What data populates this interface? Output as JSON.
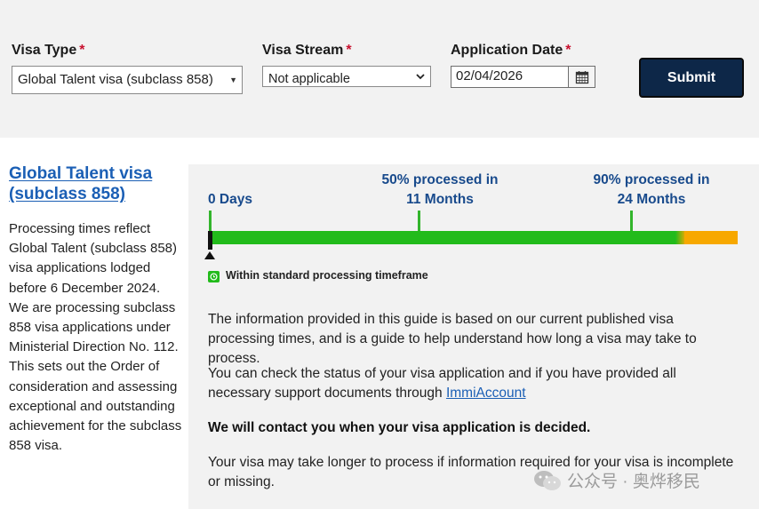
{
  "form": {
    "visa_type": {
      "label": "Visa Type",
      "required_mark": "*",
      "value": "Global Talent visa (subclass 858)"
    },
    "visa_stream": {
      "label": "Visa Stream",
      "required_mark": "*",
      "value": "Not applicable"
    },
    "application_date": {
      "label": "Application Date",
      "required_mark": "*",
      "value": "02/04/2026"
    },
    "submit_label": "Submit"
  },
  "visa": {
    "title_line1": "Global Talent visa",
    "title_line2": "(subclass 858)",
    "description": "Processing times reflect Global Talent (subclass 858) visa applications lodged before 6 December 2024. We are processing subclass 858 visa applications under Ministerial Direction No. 112. This sets out the Order of consideration and assessing exceptional and outstanding achievement for the subclass 858 visa."
  },
  "timeline": {
    "start": {
      "line1": "0 Days"
    },
    "p50": {
      "line1": "50% processed in",
      "line2": "11 Months"
    },
    "p90": {
      "line1": "90% processed in",
      "line2": "24 Months"
    },
    "legend": "Within standard processing timeframe",
    "colors": {
      "within": "#22bb1b",
      "beyond": "#f7a800"
    }
  },
  "info": {
    "p1": "The information provided in this guide is based on our current published visa processing times, and is a guide to help understand how long a visa may take to process.",
    "p2_before": "You can check the status of your visa application and if you have provided all necessary support documents through ",
    "p2_link": "ImmiAccount",
    "p3": "We will contact you when your visa application is decided.",
    "p4": "Your visa may take longer to process if information required for your visa is incomplete or missing."
  },
  "watermark": {
    "text": "公众号 · 奥烨移民"
  }
}
